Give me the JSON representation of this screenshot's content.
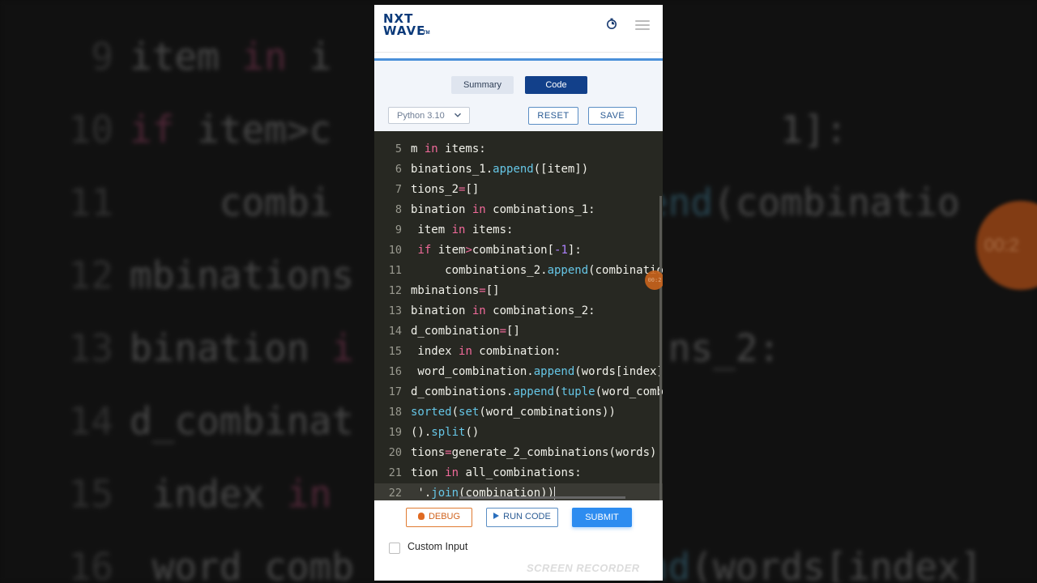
{
  "background": {
    "lines": [
      {
        "num": "9",
        "parts": [
          {
            "t": "item ",
            "c": ""
          },
          {
            "t": "in",
            "c": "kw"
          },
          {
            "t": " i",
            "c": ""
          }
        ]
      },
      {
        "num": "10",
        "parts": [
          {
            "t": "if",
            "c": "kw"
          },
          {
            "t": " item>c",
            "c": ""
          },
          {
            "t": "                    1]:",
            "c": ""
          }
        ]
      },
      {
        "num": "11",
        "parts": [
          {
            "t": "    combi",
            "c": ""
          },
          {
            "t": "             ",
            "c": ""
          },
          {
            "t": "pend",
            "c": "fn"
          },
          {
            "t": "(combinatio",
            "c": ""
          }
        ]
      },
      {
        "num": "12",
        "parts": [
          {
            "t": "mbinations",
            "c": ""
          }
        ]
      },
      {
        "num": "13",
        "parts": [
          {
            "t": "bination ",
            "c": ""
          },
          {
            "t": "i",
            "c": "kw"
          },
          {
            "t": "              ns_2:",
            "c": ""
          }
        ]
      },
      {
        "num": "14",
        "parts": [
          {
            "t": "d_combinat",
            "c": ""
          }
        ]
      },
      {
        "num": "15",
        "parts": [
          {
            "t": " index ",
            "c": ""
          },
          {
            "t": "in",
            "c": "kw"
          }
        ]
      },
      {
        "num": "16",
        "parts": [
          {
            "t": " word_comb",
            "c": ""
          },
          {
            "t": "             ",
            "c": ""
          },
          {
            "t": "nd",
            "c": "fn"
          },
          {
            "t": "(words[index]",
            "c": ""
          }
        ]
      }
    ],
    "recorder_time": "00:2"
  },
  "app": {
    "logo_line1": "NXT",
    "logo_line2": "WAVE",
    "logo_tm": "TM",
    "timer_icon": "stopwatch-icon",
    "menu_icon": "hamburger-menu-icon",
    "accent_color": "#4a90d9",
    "tabs": {
      "summary": "Summary",
      "code": "Code"
    },
    "language": "Python 3.10",
    "reset_label": "RESET",
    "save_label": "SAVE",
    "debug_label": "DEBUG",
    "run_label": "RUN CODE",
    "submit_label": "SUBMIT",
    "custom_input_label": "Custom Input",
    "watermark": "SCREEN RECORDER",
    "recorder_time": "00:2"
  },
  "editor": {
    "lines": [
      {
        "num": "5",
        "parts": [
          {
            "t": "m ",
            "c": ""
          },
          {
            "t": "in",
            "c": "kw"
          },
          {
            "t": " items:",
            "c": ""
          }
        ]
      },
      {
        "num": "6",
        "parts": [
          {
            "t": "binations_1.",
            "c": ""
          },
          {
            "t": "append",
            "c": "fn"
          },
          {
            "t": "([item])",
            "c": ""
          }
        ]
      },
      {
        "num": "7",
        "parts": [
          {
            "t": "tions_2",
            "c": ""
          },
          {
            "t": "=",
            "c": "kw"
          },
          {
            "t": "[]",
            "c": ""
          }
        ]
      },
      {
        "num": "8",
        "parts": [
          {
            "t": "bination ",
            "c": ""
          },
          {
            "t": "in",
            "c": "kw"
          },
          {
            "t": " combinations_1:",
            "c": ""
          }
        ]
      },
      {
        "num": "9",
        "parts": [
          {
            "t": " item ",
            "c": ""
          },
          {
            "t": "in",
            "c": "kw"
          },
          {
            "t": " items:",
            "c": ""
          }
        ]
      },
      {
        "num": "10",
        "parts": [
          {
            "t": " ",
            "c": ""
          },
          {
            "t": "if",
            "c": "kw"
          },
          {
            "t": " item",
            "c": ""
          },
          {
            "t": ">",
            "c": "kw"
          },
          {
            "t": "combination[",
            "c": ""
          },
          {
            "t": "-1",
            "c": "num"
          },
          {
            "t": "]:",
            "c": ""
          }
        ]
      },
      {
        "num": "11",
        "parts": [
          {
            "t": "     combinations_2.",
            "c": ""
          },
          {
            "t": "append",
            "c": "fn"
          },
          {
            "t": "(combinatio",
            "c": ""
          }
        ]
      },
      {
        "num": "12",
        "parts": [
          {
            "t": "mbinations",
            "c": ""
          },
          {
            "t": "=",
            "c": "kw"
          },
          {
            "t": "[]",
            "c": ""
          }
        ]
      },
      {
        "num": "13",
        "parts": [
          {
            "t": "bination ",
            "c": ""
          },
          {
            "t": "in",
            "c": "kw"
          },
          {
            "t": " combinations_2:",
            "c": ""
          }
        ]
      },
      {
        "num": "14",
        "parts": [
          {
            "t": "d_combination",
            "c": ""
          },
          {
            "t": "=",
            "c": "kw"
          },
          {
            "t": "[]",
            "c": ""
          }
        ]
      },
      {
        "num": "15",
        "parts": [
          {
            "t": " index ",
            "c": ""
          },
          {
            "t": "in",
            "c": "kw"
          },
          {
            "t": " combination:",
            "c": ""
          }
        ]
      },
      {
        "num": "16",
        "parts": [
          {
            "t": " word_combination.",
            "c": ""
          },
          {
            "t": "append",
            "c": "fn"
          },
          {
            "t": "(words[index]",
            "c": ""
          }
        ]
      },
      {
        "num": "17",
        "parts": [
          {
            "t": "d_combinations.",
            "c": ""
          },
          {
            "t": "append",
            "c": "fn"
          },
          {
            "t": "(",
            "c": ""
          },
          {
            "t": "tuple",
            "c": "fn"
          },
          {
            "t": "(word_comb",
            "c": ""
          }
        ]
      },
      {
        "num": "18",
        "parts": [
          {
            "t": "sorted",
            "c": "fn"
          },
          {
            "t": "(",
            "c": ""
          },
          {
            "t": "set",
            "c": "fn"
          },
          {
            "t": "(word_combinations))",
            "c": ""
          }
        ]
      },
      {
        "num": "19",
        "parts": [
          {
            "t": "().",
            "c": ""
          },
          {
            "t": "split",
            "c": "fn"
          },
          {
            "t": "()",
            "c": ""
          }
        ]
      },
      {
        "num": "20",
        "parts": [
          {
            "t": "tions",
            "c": ""
          },
          {
            "t": "=",
            "c": "kw"
          },
          {
            "t": "generate_2_combinations(words)",
            "c": ""
          }
        ]
      },
      {
        "num": "21",
        "parts": [
          {
            "t": "tion ",
            "c": ""
          },
          {
            "t": "in",
            "c": "kw"
          },
          {
            "t": " all_combinations:",
            "c": ""
          }
        ]
      },
      {
        "num": "22",
        "parts": [
          {
            "t": " '.",
            "c": ""
          },
          {
            "t": "join",
            "c": "fn"
          },
          {
            "t": "(combination))",
            "c": ""
          }
        ],
        "active": true
      }
    ]
  }
}
